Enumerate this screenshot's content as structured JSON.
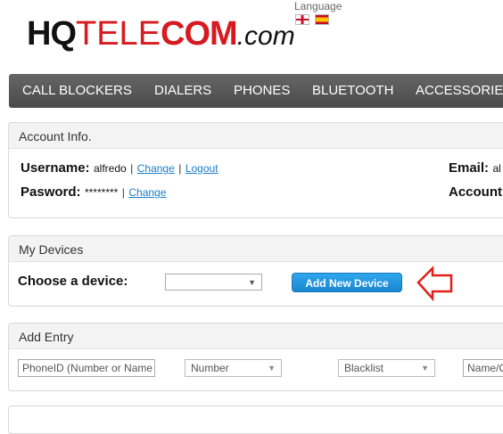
{
  "header": {
    "logo": {
      "hq": "HQ",
      "tele": "TELE",
      "com": "COM",
      "dotcom": ".com"
    },
    "language_label": "Language",
    "flags": [
      "uk-flag-icon",
      "spain-flag-icon"
    ]
  },
  "nav": {
    "items": [
      "CALL BLOCKERS",
      "DIALERS",
      "PHONES",
      "BLUETOOTH",
      "ACCESSORIES"
    ]
  },
  "account": {
    "title": "Account Info.",
    "username_label": "Username:",
    "username": "alfredo",
    "change_label": "Change",
    "logout_label": "Logout",
    "password_label": "Pasword:",
    "password": "********",
    "password_change_label": "Change",
    "email_label": "Email:",
    "email_value": "al",
    "account_label": "Account"
  },
  "devices": {
    "title": "My Devices",
    "choose_label": "Choose a device:",
    "select_value": "",
    "add_button": "Add New Device"
  },
  "entry": {
    "title": "Add Entry",
    "phoneid_placeholder": "PhoneID (Number or Name",
    "number_select": "Number",
    "list_select": "Blacklist",
    "name_placeholder": "Name/C"
  },
  "colors": {
    "brand_red": "#d71920",
    "nav_bg": "#555555",
    "button_blue": "#1b86d0",
    "arrow_red": "#e0201c"
  }
}
